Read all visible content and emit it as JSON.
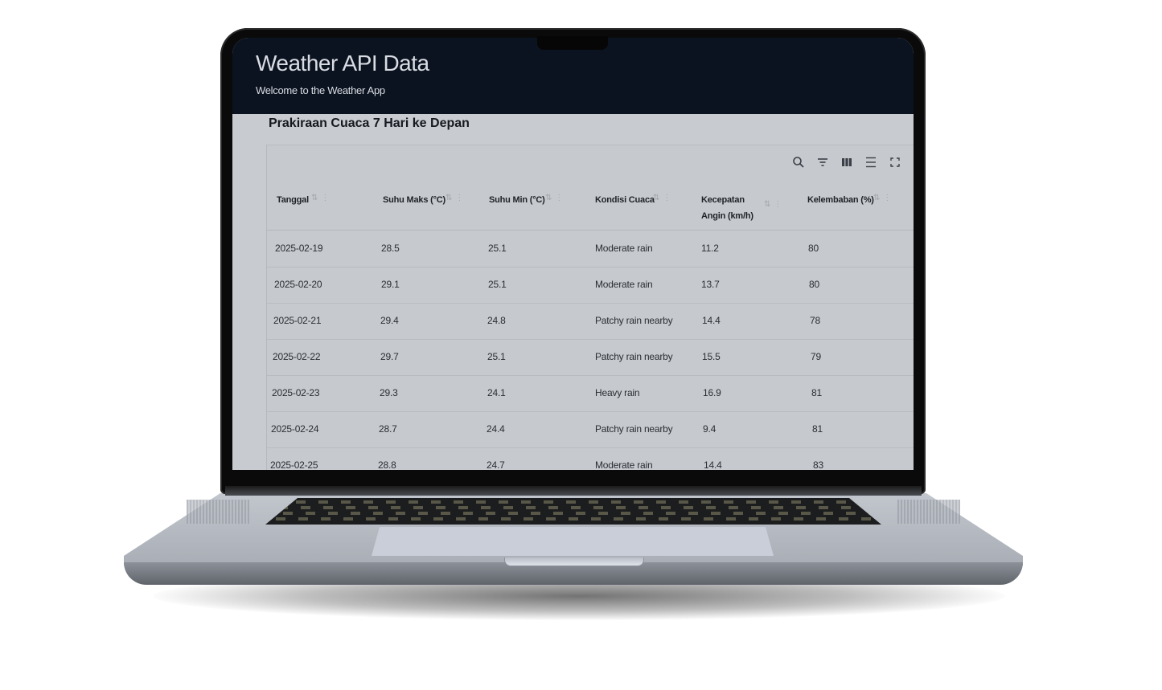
{
  "app": {
    "title": "Weather API Data",
    "subtitle": "Welcome to the Weather App"
  },
  "section_title": "Prakiraan Cuaca 7 Hari ke Depan",
  "toolbar": {
    "icons": [
      "search-icon",
      "filter-icon",
      "columns-icon",
      "density-icon",
      "fullscreen-icon"
    ]
  },
  "table": {
    "columns": [
      {
        "label": "Tanggal"
      },
      {
        "label": "Suhu Maks (°C)"
      },
      {
        "label": "Suhu Min (°C)"
      },
      {
        "label": "Kondisi Cuaca"
      },
      {
        "label_line1": "Kecepatan",
        "label_line2": "Angin (km/h)"
      },
      {
        "label": "Kelembaban (%)"
      }
    ],
    "rows": [
      {
        "date": "2025-02-19",
        "max": "28.5",
        "min": "25.1",
        "condition": "Moderate rain",
        "wind": "11.2",
        "humidity": "80"
      },
      {
        "date": "2025-02-20",
        "max": "29.1",
        "min": "25.1",
        "condition": "Moderate rain",
        "wind": "13.7",
        "humidity": "80"
      },
      {
        "date": "2025-02-21",
        "max": "29.4",
        "min": "24.8",
        "condition": "Patchy rain nearby",
        "wind": "14.4",
        "humidity": "78"
      },
      {
        "date": "2025-02-22",
        "max": "29.7",
        "min": "25.1",
        "condition": "Patchy rain nearby",
        "wind": "15.5",
        "humidity": "79"
      },
      {
        "date": "2025-02-23",
        "max": "29.3",
        "min": "24.1",
        "condition": "Heavy rain",
        "wind": "16.9",
        "humidity": "81"
      },
      {
        "date": "2025-02-24",
        "max": "28.7",
        "min": "24.4",
        "condition": "Patchy rain nearby",
        "wind": "9.4",
        "humidity": "81"
      },
      {
        "date": "2025-02-25",
        "max": "28.8",
        "min": "24.7",
        "condition": "Moderate rain",
        "wind": "14.4",
        "humidity": "83"
      }
    ]
  },
  "colors": {
    "header_bg": "#0c1320",
    "screen_bg": "#c8cbcf",
    "laptop_bezel": "#0a0a0a"
  }
}
